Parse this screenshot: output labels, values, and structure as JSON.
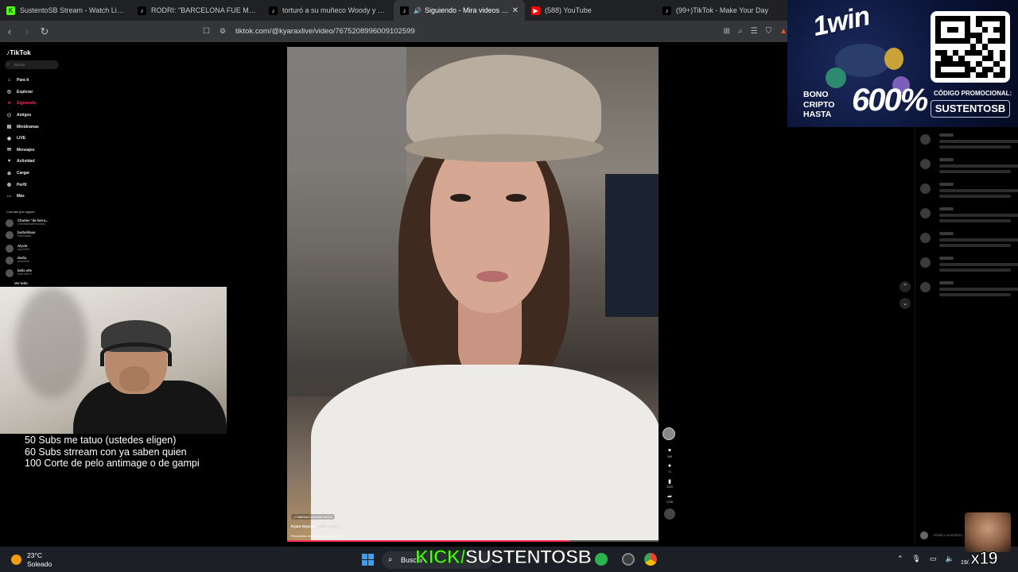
{
  "browser": {
    "tabs": [
      {
        "title": "SustentoSB Stream - Watch Live ...",
        "favicon": "kick-icon",
        "active": false
      },
      {
        "title": "RODRI: \"BARCELONA FUE MI PRIMER...",
        "favicon": "tiktok-icon",
        "active": false
      },
      {
        "title": "torturó a su muñeco Woody y esto p...",
        "favicon": "tiktok-icon",
        "active": false
      },
      {
        "title": "Siguiendo - Mira videos publ...",
        "favicon": "tiktok-icon",
        "active": true
      },
      {
        "title": "(588) YouTube",
        "favicon": "youtube-icon",
        "active": false
      },
      {
        "title": "(99+)TikTok - Make Your Day",
        "favicon": "tiktok-icon",
        "active": false
      }
    ],
    "url": "tiktok.com/@kyaraxlive/video/7675208996009102599"
  },
  "tiktok": {
    "logo": "TikTok",
    "search_placeholder": "Buscar",
    "menu": [
      {
        "label": "Para ti",
        "icon": "home-icon",
        "highlight": false
      },
      {
        "label": "Explorar",
        "icon": "compass-icon",
        "highlight": false
      },
      {
        "label": "Siguiendo",
        "icon": "following-icon",
        "highlight": true
      },
      {
        "label": "Amigos",
        "icon": "friends-icon",
        "highlight": false
      },
      {
        "label": "Minidramas",
        "icon": "minidrama-icon",
        "highlight": false
      },
      {
        "label": "LIVE",
        "icon": "live-icon",
        "highlight": false
      },
      {
        "label": "Mensajes",
        "icon": "messages-icon",
        "highlight": false
      },
      {
        "label": "Actividad",
        "icon": "activity-icon",
        "highlight": false
      },
      {
        "label": "Cargar",
        "icon": "upload-icon",
        "highlight": false
      },
      {
        "label": "Perfil",
        "icon": "profile-icon",
        "highlight": false
      },
      {
        "label": "Más",
        "icon": "more-icon",
        "highlight": false
      }
    ],
    "following_heading": "Cuentas que sigues",
    "following": [
      {
        "name": "Charles \"de tierra...",
        "handle": "charlesdelatierraoficial"
      },
      {
        "name": "barbolitaaa",
        "handle": "barbolitaaa"
      },
      {
        "name": "Alyvie",
        "handle": "alyvie999"
      },
      {
        "name": "dudia",
        "handle": "peepdudi..."
      },
      {
        "name": "bello elle",
        "handle": "bello.elle74"
      },
      {
        "name": "Ver todo",
        "handle": ""
      }
    ],
    "video": {
      "music": "Sabrina Carpenter nuevo",
      "author": "Kyara Nayumi",
      "time": "· Hace 1 día(s)",
      "caption": "Recuerdas este tema? #tiktok #viral",
      "progress": 0.76
    },
    "actions": [
      {
        "icon": "heart-icon",
        "count": "34K"
      },
      {
        "icon": "comment-icon",
        "count": "71"
      },
      {
        "icon": "bookmark-icon",
        "count": "2220"
      },
      {
        "icon": "share-icon",
        "count": "1735"
      }
    ],
    "add_comment_placeholder": "Añadir comentario..."
  },
  "stream": {
    "sub_goals": [
      "50 Subs me tatuo (ustedes eligen)",
      "60 Subs strream con ya saben quien",
      "100 Corte de pelo antimage o de gampi"
    ],
    "kick_prefix": "KICK/",
    "kick_channel": "SUSTENTOSB",
    "emote_label": "x19"
  },
  "ad": {
    "brand": "1win",
    "bono_lines": [
      "BONO",
      "CRIPTO",
      "HASTA"
    ],
    "percent": "600%",
    "code_label": "CÓDIGO PROMOCIONAL:",
    "code": "SUSTENTOSB"
  },
  "taskbar": {
    "temperature": "23°C",
    "weather": "Soleado",
    "search_label": "Buscar",
    "clock": "19/..."
  }
}
